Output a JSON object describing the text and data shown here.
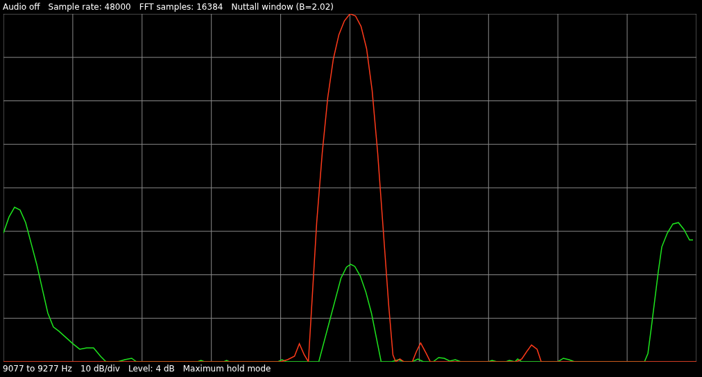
{
  "header": [
    "Audio off",
    "Sample rate: 48000",
    "FFT samples: 16384",
    "Nuttall window (B=2.02)"
  ],
  "footer": [
    "9077 to 9277 Hz",
    "10 dB/div",
    "Level: 4 dB",
    "Maximum hold mode"
  ]
}
